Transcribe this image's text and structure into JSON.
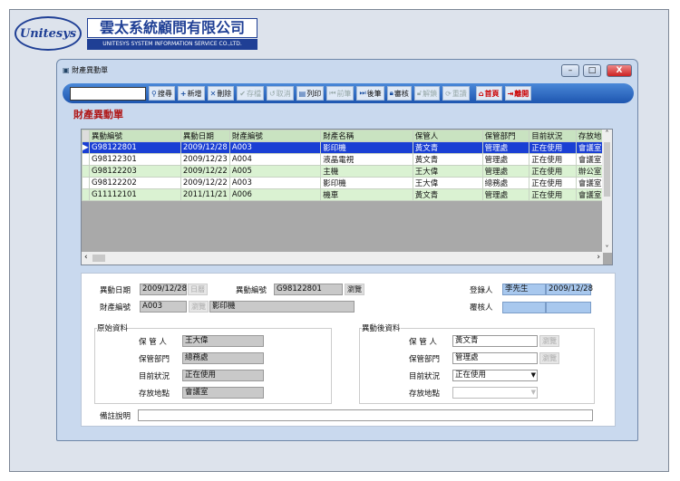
{
  "brand": {
    "logo_text": "Unitesys",
    "name_zh": "雲太系統顧問有限公司",
    "name_en": "UNITESYS SYSTEM INFORMATION SERVICE CO.,LTD."
  },
  "window": {
    "title": "財產異動單",
    "min": "–",
    "max": "□",
    "close": "X"
  },
  "toolbar": {
    "search_value": "",
    "search": "搜尋",
    "add": "新增",
    "delete": "刪除",
    "save": "存檔",
    "cancel": "取消",
    "print": "列印",
    "prev": "前筆",
    "next": "後筆",
    "audit": "審核",
    "unlock": "解鎖",
    "reload": "重讀",
    "home": "首頁",
    "exit": "離開"
  },
  "heading": "財產異動單",
  "grid": {
    "columns": [
      "異動編號",
      "異動日期",
      "財產編號",
      "財產名稱",
      "保管人",
      "保管部門",
      "目前狀況",
      "存放地點"
    ],
    "rows": [
      [
        "G98122801",
        "2009/12/28",
        "A003",
        "影印機",
        "黃文青",
        "管理處",
        "正在使用",
        "會議室"
      ],
      [
        "G98122301",
        "2009/12/23",
        "A004",
        "液晶電視",
        "黃文青",
        "管理處",
        "正在使用",
        "會議室"
      ],
      [
        "G98122203",
        "2009/12/22",
        "A005",
        "主機",
        "王大偉",
        "管理處",
        "正在使用",
        "辦公室"
      ],
      [
        "G98122202",
        "2009/12/22",
        "A003",
        "影印機",
        "王大偉",
        "總務處",
        "正在使用",
        "會議室"
      ],
      [
        "G11112101",
        "2011/11/21",
        "A006",
        "機車",
        "黃文青",
        "管理處",
        "正在使用",
        "會議室"
      ]
    ]
  },
  "form": {
    "change_date_label": "異動日期",
    "change_date": "2009/12/28",
    "date_btn": "日曆",
    "change_no_label": "異動編號",
    "change_no": "G98122801",
    "browse": "瀏覽",
    "asset_no_label": "財產編號",
    "asset_no": "A003",
    "asset_name": "影印機",
    "recorder_label": "登錄人",
    "recorder": "李先生",
    "record_date": "2009/12/28",
    "reviewer_label": "覆核人",
    "reviewer": "",
    "review_date": "",
    "original": {
      "title": "原始資料",
      "keeper_label": "保 管 人",
      "keeper": "王大偉",
      "dept_label": "保管部門",
      "dept": "總務處",
      "status_label": "目前狀況",
      "status": "正在使用",
      "location_label": "存放地點",
      "location": "會議室"
    },
    "after": {
      "title": "異動後資料",
      "keeper_label": "保 管 人",
      "keeper": "黃文青",
      "dept_label": "保管部門",
      "dept": "管理處",
      "status_label": "目前狀況",
      "status": "正在使用",
      "location_label": "存放地點",
      "location": ""
    },
    "remark_label": "備註說明",
    "remark": ""
  }
}
